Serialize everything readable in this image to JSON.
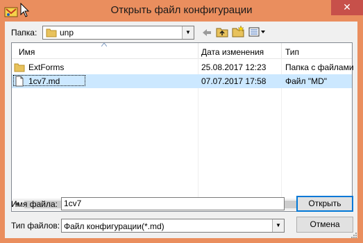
{
  "window": {
    "title": "Открыть файл конфигурации",
    "close_label": "✕"
  },
  "toolbar": {
    "folder_label": "Папка:",
    "folder_value": "unp"
  },
  "list": {
    "columns": [
      "Имя",
      "Дата изменения",
      "Тип"
    ],
    "rows": [
      {
        "name": "ExtForms",
        "date": "25.08.2017 12:23",
        "type": "Папка с файлами",
        "icon": "folder-icon",
        "selected": false
      },
      {
        "name": "1cv7.md",
        "date": "07.07.2017 17:58",
        "type": "Файл \"MD\"",
        "icon": "file-icon",
        "selected": true
      }
    ]
  },
  "form": {
    "filename_label": "Имя файла:",
    "filename_value": "1cv7",
    "filetype_label": "Тип файлов:",
    "filetype_value": "Файл конфигурации(*.md)",
    "open_button": "Открыть",
    "cancel_button": "Отмена"
  },
  "colors": {
    "titlebar": "#ea8e5e",
    "close_button": "#c7504a",
    "selection": "#cce8ff",
    "folder": "#e8c25c"
  }
}
